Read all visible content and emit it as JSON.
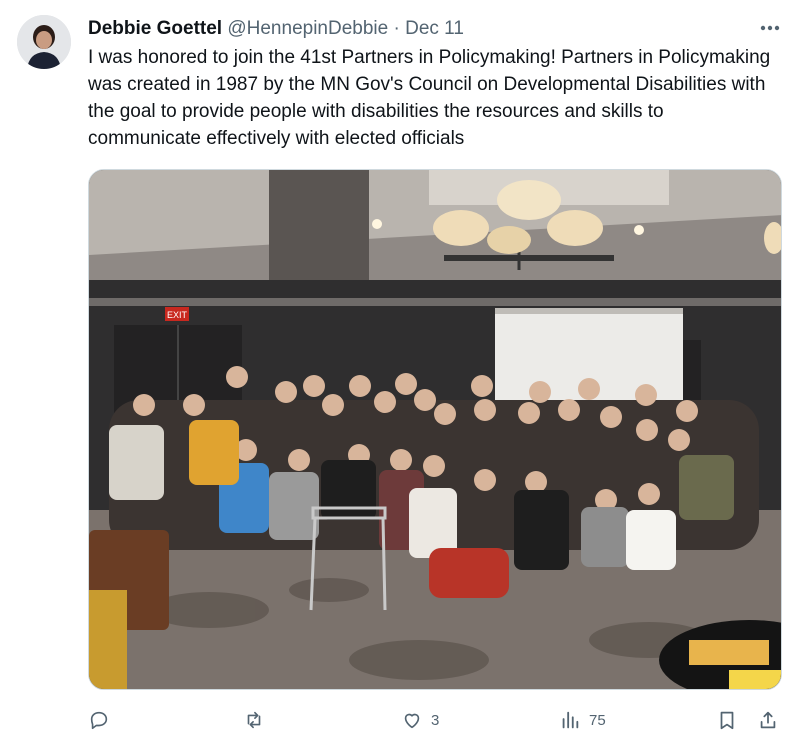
{
  "tweet": {
    "author_name": "Debbie Goettel",
    "handle": "@HennepinDebbie",
    "separator": "·",
    "date": "Dec 11",
    "text": "I was honored to join the 41st Partners in Policymaking! Partners in Policymaking was created in 1987 by the MN Gov's Council on Developmental Disabilities with the goal to provide people with disabilities the resources and skills to communicate effectively with elected officials",
    "more_icon": "more-dots-icon"
  },
  "actions": {
    "reply_icon": "reply-icon",
    "retweet_icon": "retweet-icon",
    "like_icon": "heart-icon",
    "like_count": "3",
    "views_icon": "views-chart-icon",
    "views_count": "75",
    "bookmark_icon": "bookmark-icon",
    "share_icon": "share-icon"
  },
  "media": {
    "exit_sign": "EXIT"
  },
  "colors": {
    "text_primary": "#0f1419",
    "text_secondary": "#536471",
    "border": "#cfd9de"
  }
}
